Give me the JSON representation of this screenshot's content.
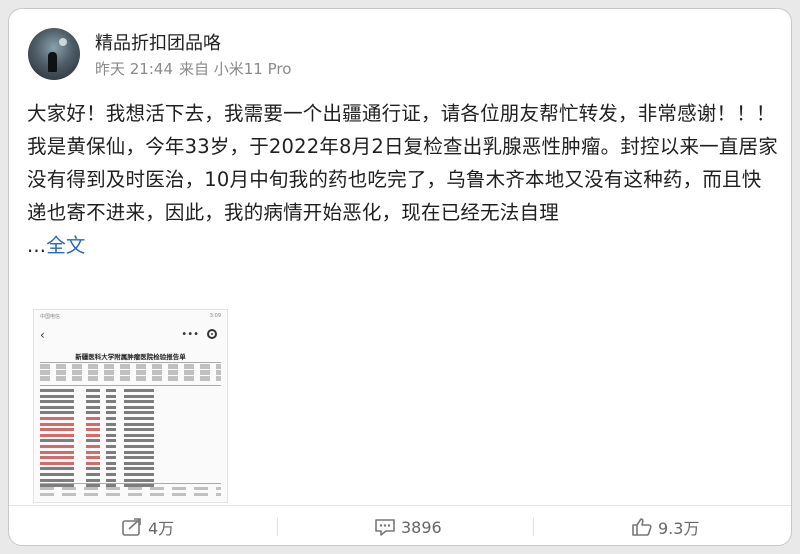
{
  "post": {
    "username": "精品折扣团品咯",
    "time": "昨天 21:44",
    "source": "来自 小米11 Pro",
    "paragraph1": "大家好！我想活下去，我需要一个出疆通行证，请各位朋友帮忙转发，非常感谢！！！",
    "paragraph2": "我是黄保仙，今年33岁，于2022年8月2日复检查出乳腺恶性肿瘤。封控以来一直居家没有得到及时医治，10月中旬我的药也吃完了，乌鲁木齐本地又没有这种药，而且快递也寄不进来，因此，我的病情开始恶化，现在已经无法自理",
    "ellipsis": "...",
    "full_text_link": "全文"
  },
  "attachment": {
    "status_left": "中国电信",
    "status_right": "3:09",
    "title": "新疆医科大学附属肿瘤医院检验报告单"
  },
  "actions": {
    "repost_count": "4万",
    "comment_count": "3896",
    "like_count": "9.3万"
  },
  "icons": {
    "repost": "share-icon",
    "comment": "comment-icon",
    "like": "thumbs-up-icon"
  },
  "colors": {
    "link": "#2a66c4",
    "text": "#1f1f1f",
    "meta": "#8a8a8a"
  }
}
